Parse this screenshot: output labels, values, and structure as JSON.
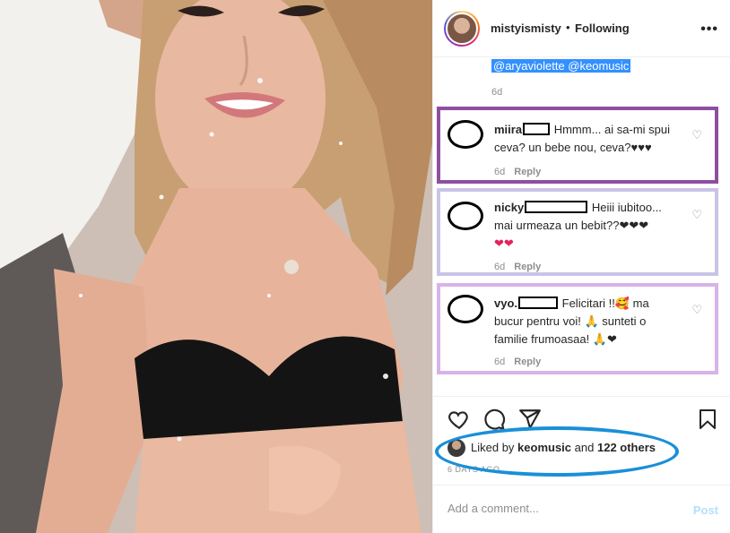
{
  "post": {
    "username": "mistyismisty",
    "separator": "•",
    "following_label": "Following",
    "more_label": "•••",
    "caption_tail": "@aryaviolette @keomusic",
    "caption_time": "6d"
  },
  "comments": [
    {
      "user": "miira",
      "text_lines": [
        "Hmmm... ai sa-mi spui",
        "ceva? un bebe nou, ceva?♥♥♥"
      ],
      "time": "6d",
      "reply_label": "Reply",
      "box_color": "#8e4fa1"
    },
    {
      "user": "nicky",
      "text_lines": [
        "Heiii iubitoo...",
        "mai urmeaza un bebit??❤❤❤",
        "❤❤"
      ],
      "time": "6d",
      "reply_label": "Reply",
      "box_color": "#c9c4e6"
    },
    {
      "user": "vyo.",
      "text_lines": [
        "Felicitari !!🥰 ma",
        "bucur pentru voi! 🙏 sunteti o",
        "familie frumoasaa! 🙏❤"
      ],
      "time": "6d",
      "reply_label": "Reply",
      "box_color": "#d7b3e8"
    }
  ],
  "likes": {
    "prefix": "Liked by",
    "user": "keomusic",
    "and": "and",
    "others": "122 others"
  },
  "time_ago": "6 DAYS AGO",
  "add_comment": {
    "placeholder": "Add a comment...",
    "post_label": "Post"
  },
  "icons": [
    "heart-icon",
    "comment-icon",
    "share-icon",
    "bookmark-icon",
    "more-options-icon"
  ],
  "colors": {
    "highlight": "#3390ff",
    "annotation_ellipse": "#1a8fd8",
    "post_button": "#b2dffc",
    "muted": "#8e8e8e"
  }
}
